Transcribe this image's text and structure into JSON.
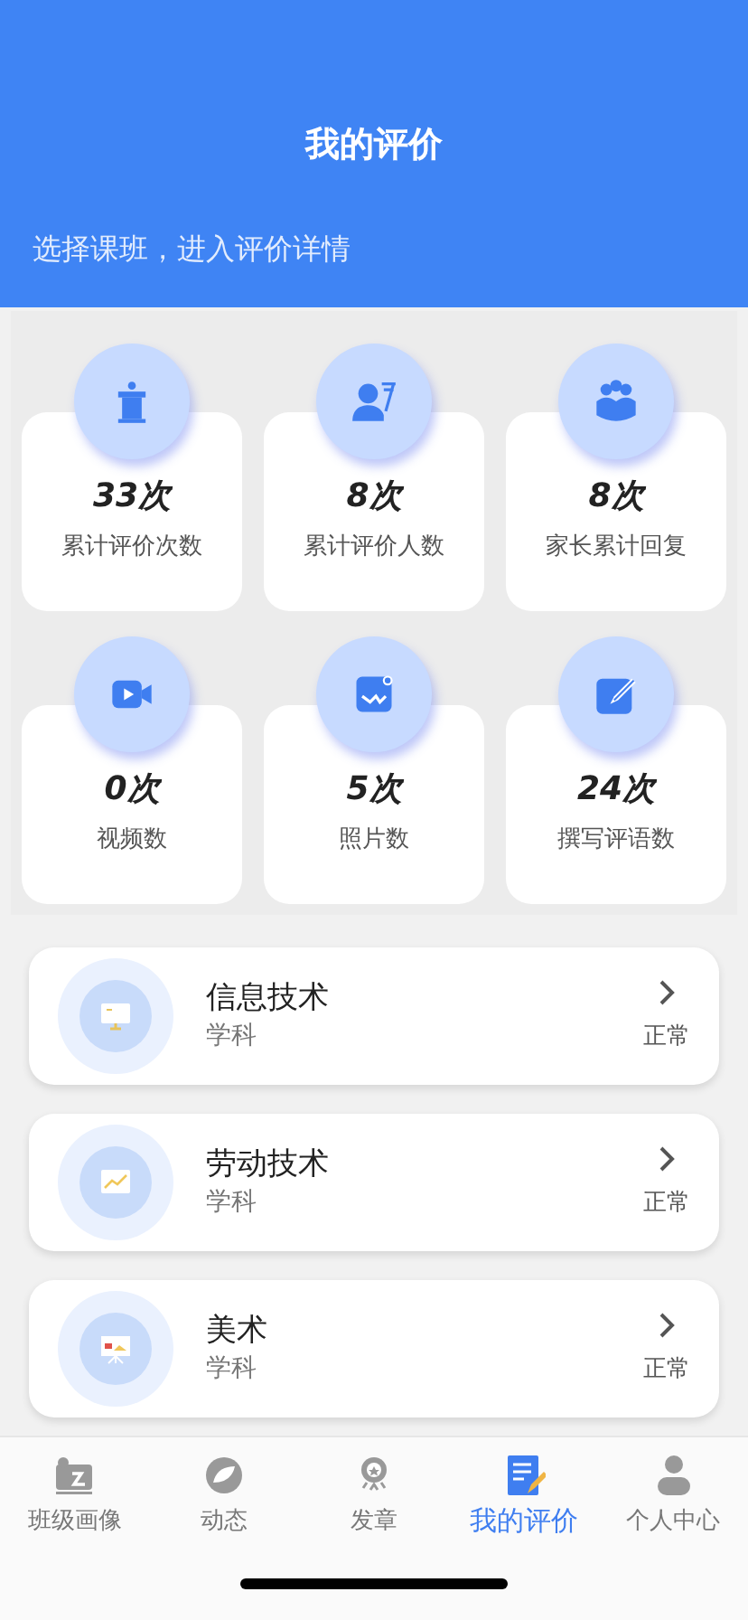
{
  "header": {
    "title": "我的评价",
    "subtitle": "选择课班，进入评价详情"
  },
  "stats": [
    {
      "value": "33次",
      "label": "累计评价次数"
    },
    {
      "value": "8次",
      "label": "累计评价人数"
    },
    {
      "value": "8次",
      "label": "家长累计回复"
    },
    {
      "value": "0次",
      "label": "视频数"
    },
    {
      "value": "5次",
      "label": "照片数"
    },
    {
      "value": "24次",
      "label": "撰写评语数"
    }
  ],
  "subjects": [
    {
      "name": "信息技术",
      "type": "学科",
      "status": "正常"
    },
    {
      "name": "劳动技术",
      "type": "学科",
      "status": "正常"
    },
    {
      "name": "美术",
      "type": "学科",
      "status": "正常"
    }
  ],
  "tab_bar": [
    {
      "label": "班级画像",
      "selected": false
    },
    {
      "label": "动态",
      "selected": false
    },
    {
      "label": "发章",
      "selected": false
    },
    {
      "label": "我的评价",
      "selected": true
    },
    {
      "label": "个人中心",
      "selected": false
    }
  ]
}
